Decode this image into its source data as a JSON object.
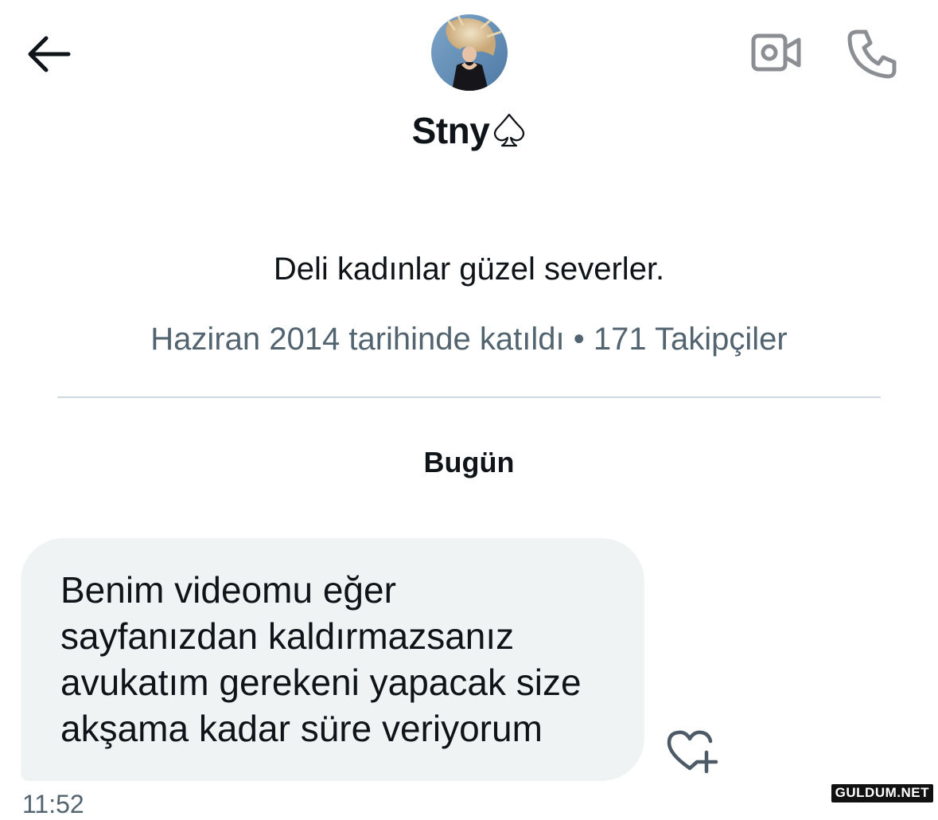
{
  "header": {
    "back_icon": "arrow-left-icon",
    "video_icon": "video-camera-icon",
    "call_icon": "phone-icon",
    "display_name": "Stny",
    "name_icon": "spade-icon"
  },
  "profile": {
    "bio": "Deli kadınlar güzel severler.",
    "meta": "Haziran 2014 tarihinde katıldı • 171 Takipçiler"
  },
  "conversation": {
    "day_label": "Bugün",
    "messages": [
      {
        "text": "Benim videomu eğer\nsayfanızdan kaldırmazsanız\navukatım gerekeni yapacak size\nakşama kadar süre veriyorum",
        "time": "11:52",
        "reaction_icon": "heart-plus-icon"
      }
    ]
  },
  "watermark": "GULDUM.NET",
  "colors": {
    "bubble_bg": "#eff3f4",
    "secondary_text": "#536471",
    "divider": "#cfd9de",
    "icon_gray": "#8b8f94"
  }
}
